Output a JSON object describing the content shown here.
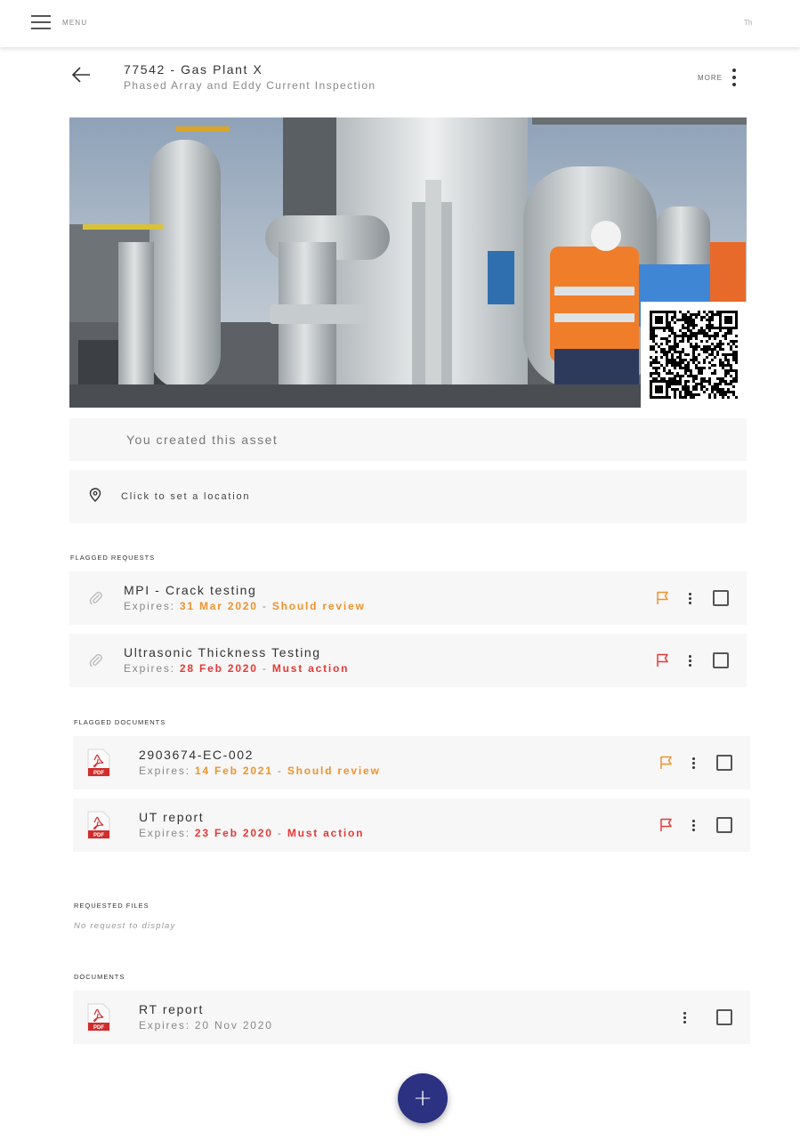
{
  "topbar": {
    "menu_label": "MENU",
    "right_text": "Th",
    "menu_icon": "hamburger-menu-icon"
  },
  "header": {
    "back_icon": "arrow-left-icon",
    "title": "77542 - Gas Plant X",
    "subtitle": "Phased Array and Eddy Current Inspection",
    "more_label": "MORE",
    "more_icon": "vertical-dots-icon"
  },
  "asset": {
    "created_text": "You created this asset",
    "location_text": "Click to set a location",
    "location_icon": "map-pin-icon"
  },
  "flagged_requests": {
    "label": "FLAGGED REQUESTS",
    "items": [
      {
        "title": "MPI - Crack testing",
        "expires_prefix": "Expires: ",
        "date": "31 Mar 2020",
        "separator": " - ",
        "status": "Should review",
        "status_color": "#f0922c"
      },
      {
        "title": "Ultrasonic Thickness Testing",
        "expires_prefix": "Expires: ",
        "date": "28 Feb 2020",
        "separator": " - ",
        "status": "Must action",
        "status_color": "#e53935"
      }
    ]
  },
  "flagged_documents": {
    "label": "FLAGGED DOCUMENTS",
    "items": [
      {
        "title": "2903674-EC-002",
        "expires_prefix": "Expires: ",
        "date": "14 Feb 2021",
        "separator": " - ",
        "status": "Should review",
        "status_color": "#f0922c"
      },
      {
        "title": "UT report",
        "expires_prefix": "Expires: ",
        "date": "23 Feb 2020",
        "separator": " - ",
        "status": "Must action",
        "status_color": "#e53935"
      }
    ]
  },
  "requested_files": {
    "label": "REQUESTED FILES",
    "empty_text": "No request to display"
  },
  "documents": {
    "label": "DOCUMENTS",
    "items": [
      {
        "title": "RT report",
        "expires": "Expires: 20 Nov 2020"
      }
    ]
  },
  "pdf_badge": "PDF",
  "fab": {
    "label": "+"
  },
  "colors": {
    "should_review": "#f0922c",
    "must_action": "#e53935",
    "fab": "#2c3182"
  }
}
